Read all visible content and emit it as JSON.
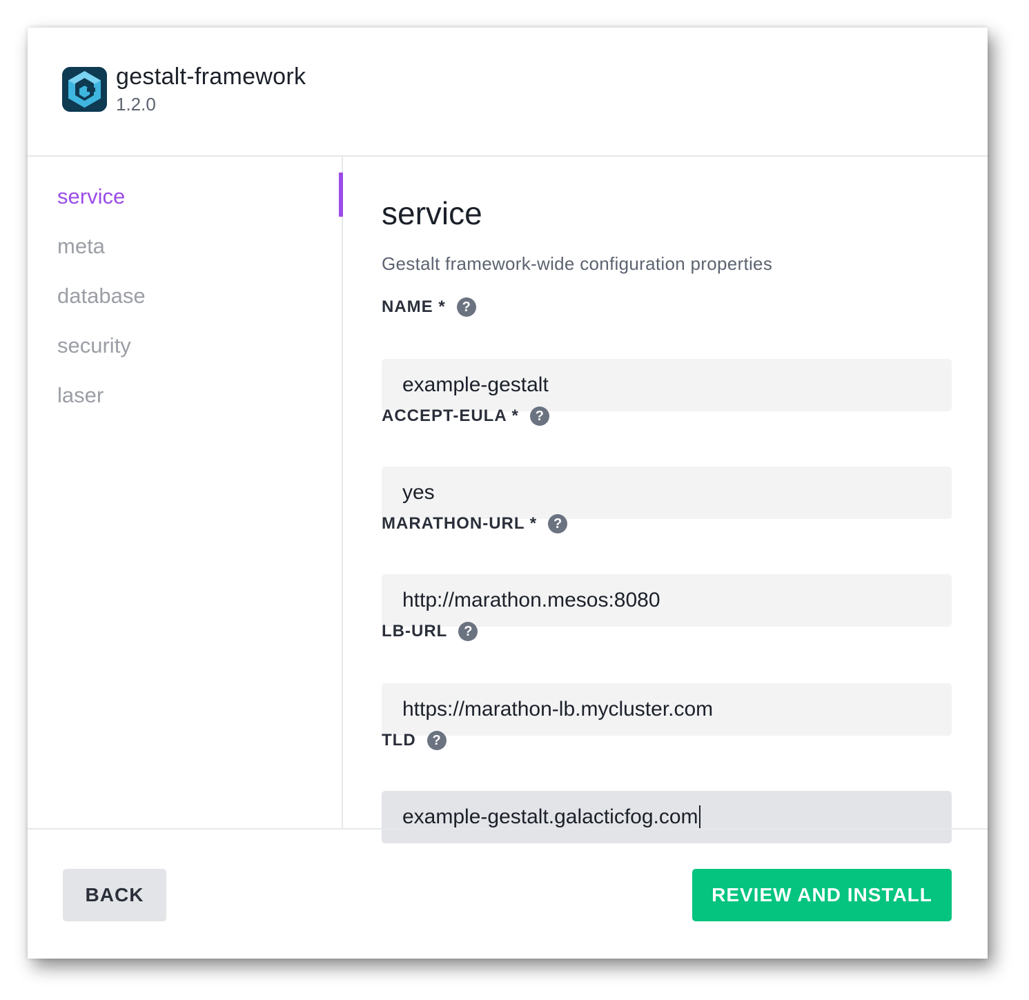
{
  "header": {
    "app_name": "gestalt-framework",
    "app_version": "1.2.0",
    "logo_icon": "gestalt-logo"
  },
  "sidebar": {
    "active_color": "#9b4ce8",
    "items": [
      {
        "label": "service",
        "active": true
      },
      {
        "label": "meta",
        "active": false
      },
      {
        "label": "database",
        "active": false
      },
      {
        "label": "security",
        "active": false
      },
      {
        "label": "laser",
        "active": false
      }
    ]
  },
  "content": {
    "section_title": "service",
    "section_description": "Gestalt framework-wide configuration properties",
    "fields": [
      {
        "label": "NAME *",
        "value": "example-gestalt",
        "help_icon": "question-circle-icon"
      },
      {
        "label": "ACCEPT-EULA *",
        "value": "yes",
        "help_icon": "question-circle-icon"
      },
      {
        "label": "MARATHON-URL *",
        "value": "http://marathon.mesos:8080",
        "help_icon": "question-circle-icon"
      },
      {
        "label": "LB-URL",
        "value": "https://marathon-lb.mycluster.com",
        "help_icon": "question-circle-icon"
      },
      {
        "label": "TLD",
        "value": "example-gestalt.galacticfog.com",
        "help_icon": "question-circle-icon",
        "focused": true
      }
    ],
    "help_glyph": "?"
  },
  "footer": {
    "back_label": "BACK",
    "install_label": "REVIEW AND INSTALL",
    "install_color": "#04c47f"
  }
}
